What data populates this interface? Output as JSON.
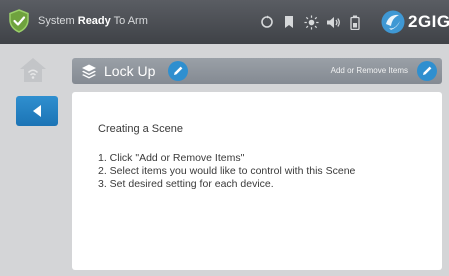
{
  "status_bar": {
    "status_prefix": "System",
    "status_bold": "Ready",
    "status_suffix": "To Arm",
    "icons": [
      "refresh-icon",
      "bookmark-icon",
      "brightness-icon",
      "volume-icon",
      "battery-icon"
    ],
    "brand": "2GIG"
  },
  "sidebar": {
    "home_icon": "home-wifi-icon",
    "back_icon": "back-arrow-icon"
  },
  "scene_header": {
    "title": "Lock Up",
    "add_remove_label": "Add or Remove Items"
  },
  "content": {
    "heading": "Creating a Scene",
    "steps": [
      "1. Click \"Add or Remove Items\"",
      "2. Select items you would like to control with this Scene",
      "3. Set desired setting for each device."
    ]
  },
  "colors": {
    "accent": "#2f8fcf",
    "status_bar": "#4a4d52",
    "header": "#8e949b",
    "arm_ready": "#7fb24a"
  }
}
